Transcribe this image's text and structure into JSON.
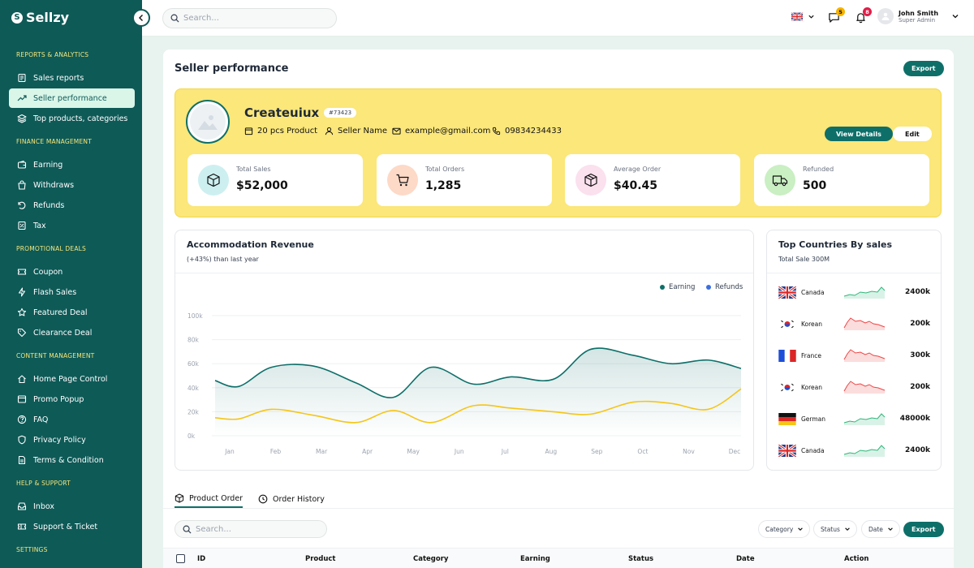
{
  "brand": {
    "name": "Sellzy"
  },
  "sidebar": {
    "sections": [
      {
        "title": "REPORTS & ANALYTICS",
        "items": [
          {
            "label": "Sales reports",
            "icon": "sales-report-icon"
          },
          {
            "label": "Seller performance",
            "icon": "trend-icon",
            "active": true
          },
          {
            "label": "Top products, categories",
            "icon": "layers-icon"
          }
        ]
      },
      {
        "title": "FINANCE MANAGEMENT",
        "items": [
          {
            "label": "Earning",
            "icon": "wallet-icon"
          },
          {
            "label": "Withdraws",
            "icon": "bag-icon"
          },
          {
            "label": "Refunds",
            "icon": "refund-icon"
          },
          {
            "label": "Tax",
            "icon": "tax-icon"
          }
        ]
      },
      {
        "title": "PROMOTIONAL DEALS",
        "items": [
          {
            "label": "Coupon",
            "icon": "coupon-icon"
          },
          {
            "label": "Flash Sales",
            "icon": "flash-icon"
          },
          {
            "label": "Featured Deal",
            "icon": "star-icon"
          },
          {
            "label": "Clearance Deal",
            "icon": "tag-icon"
          }
        ]
      },
      {
        "title": "CONTENT MANAGEMENT",
        "items": [
          {
            "label": "Home Page Control",
            "icon": "home-icon"
          },
          {
            "label": "Promo Popup",
            "icon": "popup-icon"
          },
          {
            "label": "FAQ",
            "icon": "help-icon"
          },
          {
            "label": "Privacy Policy",
            "icon": "shield-icon"
          },
          {
            "label": "Terms & Condition",
            "icon": "document-icon"
          }
        ]
      },
      {
        "title": "HELP & SUPPORT",
        "items": [
          {
            "label": "Inbox",
            "icon": "inbox-icon"
          },
          {
            "label": "Support & Ticket",
            "icon": "ticket-icon"
          }
        ]
      },
      {
        "title": "SETTINGS",
        "items": []
      }
    ]
  },
  "topbar": {
    "search_placeholder": "Search...",
    "messages_badge": "5",
    "notifications_badge": "8",
    "user_name": "John Smith",
    "user_role": "Super Admin",
    "colors": {
      "messages_badge": "#f5b400",
      "notifications_badge": "#e11d48"
    }
  },
  "page": {
    "title": "Seller performance",
    "export_label": "Export"
  },
  "seller": {
    "name": "Createuiux",
    "id": "#73423",
    "product_count": "20 pcs Product",
    "seller_name": "Seller Name",
    "email": "example@gmail.com",
    "phone": "09834234433",
    "view_details_label": "View Details",
    "edit_label": "Edit"
  },
  "stats": [
    {
      "label": "Total Sales",
      "value": "$52,000",
      "icon": "box-icon",
      "color": "#cdeff0"
    },
    {
      "label": "Total Orders",
      "value": "1,285",
      "icon": "cart-icon",
      "color": "#fdd9c7"
    },
    {
      "label": "Average Order",
      "value": "$40.45",
      "icon": "package-icon",
      "color": "#fbe0ee"
    },
    {
      "label": "Refunded",
      "value": "500",
      "icon": "truck-icon",
      "color": "#c9efc2"
    }
  ],
  "revenue": {
    "title": "Accommodation Revenue",
    "subtitle": "(+43%) than last year"
  },
  "chart_data": {
    "type": "area",
    "title": "Accommodation Revenue",
    "categories": [
      "Jan",
      "Feb",
      "Mar",
      "Apr",
      "May",
      "Jun",
      "Jul",
      "Aug",
      "Sep",
      "Oct",
      "Nov",
      "Dec"
    ],
    "ylim": [
      0,
      100
    ],
    "ytick_labels": [
      "0k",
      "20k",
      "40k",
      "60k",
      "80k",
      "100k"
    ],
    "grid": true,
    "legend": "top-right",
    "series": [
      {
        "name": "Earning",
        "color": "#0e6f69",
        "values": [
          46,
          41,
          57,
          58,
          44,
          32,
          57,
          43,
          49,
          47,
          72,
          67,
          60,
          63,
          56
        ]
      },
      {
        "name": "Refunds",
        "color": "#f5c518",
        "values": [
          15,
          14,
          22,
          17,
          11,
          21,
          11,
          25,
          23,
          20,
          18,
          28,
          27,
          22,
          39
        ]
      }
    ],
    "x_positions": [
      0,
      0.5,
      1.2,
      2.1,
      3.0,
      3.8,
      4.6,
      5.5,
      6.3,
      7.2,
      8.0,
      8.9,
      9.7,
      10.5,
      11.2
    ]
  },
  "countries": {
    "title": "Top Countries By sales",
    "subtitle": "Total Sale 300M",
    "rows": [
      {
        "flag": "uk-flag-icon",
        "name": "Canada",
        "value": "2400k",
        "trend": "up",
        "color": "#2fb67a"
      },
      {
        "flag": "korea-flag-icon",
        "name": "Korean",
        "value": "200k",
        "trend": "down",
        "color": "#ef4444"
      },
      {
        "flag": "france-flag-icon",
        "name": "France",
        "value": "300k",
        "trend": "down",
        "color": "#ef4444"
      },
      {
        "flag": "korea-flag-icon",
        "name": "Korean",
        "value": "200k",
        "trend": "down",
        "color": "#ef4444"
      },
      {
        "flag": "germany-flag-icon",
        "name": "German",
        "value": "48000k",
        "trend": "up",
        "color": "#2fb67a"
      },
      {
        "flag": "uk-flag-icon",
        "name": "Canada",
        "value": "2400k",
        "trend": "up",
        "color": "#2fb67a"
      }
    ]
  },
  "tabs": [
    {
      "label": "Product Order",
      "active": true
    },
    {
      "label": "Order History",
      "active": false
    }
  ],
  "table": {
    "search_placeholder": "Search...",
    "filters": [
      "Category",
      "Status",
      "Date"
    ],
    "export_label": "Export",
    "columns": [
      "ID",
      "Product",
      "Category",
      "Earning",
      "Status",
      "Date",
      "Action"
    ]
  }
}
